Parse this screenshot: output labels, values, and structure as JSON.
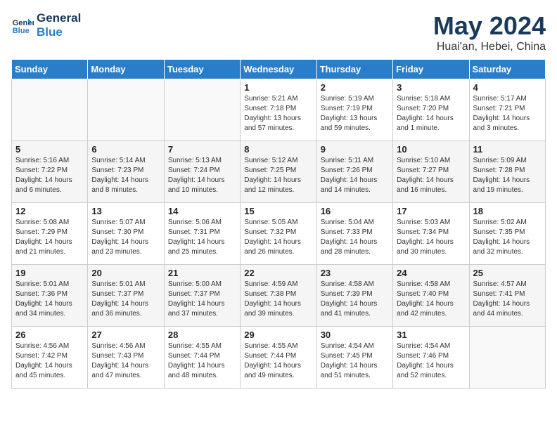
{
  "header": {
    "logo_line1": "General",
    "logo_line2": "Blue",
    "month": "May 2024",
    "location": "Huai'an, Hebei, China"
  },
  "days_of_week": [
    "Sunday",
    "Monday",
    "Tuesday",
    "Wednesday",
    "Thursday",
    "Friday",
    "Saturday"
  ],
  "weeks": [
    [
      {
        "day": "",
        "info": ""
      },
      {
        "day": "",
        "info": ""
      },
      {
        "day": "",
        "info": ""
      },
      {
        "day": "1",
        "info": "Sunrise: 5:21 AM\nSunset: 7:18 PM\nDaylight: 13 hours\nand 57 minutes."
      },
      {
        "day": "2",
        "info": "Sunrise: 5:19 AM\nSunset: 7:19 PM\nDaylight: 13 hours\nand 59 minutes."
      },
      {
        "day": "3",
        "info": "Sunrise: 5:18 AM\nSunset: 7:20 PM\nDaylight: 14 hours\nand 1 minute."
      },
      {
        "day": "4",
        "info": "Sunrise: 5:17 AM\nSunset: 7:21 PM\nDaylight: 14 hours\nand 3 minutes."
      }
    ],
    [
      {
        "day": "5",
        "info": "Sunrise: 5:16 AM\nSunset: 7:22 PM\nDaylight: 14 hours\nand 6 minutes."
      },
      {
        "day": "6",
        "info": "Sunrise: 5:14 AM\nSunset: 7:23 PM\nDaylight: 14 hours\nand 8 minutes."
      },
      {
        "day": "7",
        "info": "Sunrise: 5:13 AM\nSunset: 7:24 PM\nDaylight: 14 hours\nand 10 minutes."
      },
      {
        "day": "8",
        "info": "Sunrise: 5:12 AM\nSunset: 7:25 PM\nDaylight: 14 hours\nand 12 minutes."
      },
      {
        "day": "9",
        "info": "Sunrise: 5:11 AM\nSunset: 7:26 PM\nDaylight: 14 hours\nand 14 minutes."
      },
      {
        "day": "10",
        "info": "Sunrise: 5:10 AM\nSunset: 7:27 PM\nDaylight: 14 hours\nand 16 minutes."
      },
      {
        "day": "11",
        "info": "Sunrise: 5:09 AM\nSunset: 7:28 PM\nDaylight: 14 hours\nand 19 minutes."
      }
    ],
    [
      {
        "day": "12",
        "info": "Sunrise: 5:08 AM\nSunset: 7:29 PM\nDaylight: 14 hours\nand 21 minutes."
      },
      {
        "day": "13",
        "info": "Sunrise: 5:07 AM\nSunset: 7:30 PM\nDaylight: 14 hours\nand 23 minutes."
      },
      {
        "day": "14",
        "info": "Sunrise: 5:06 AM\nSunset: 7:31 PM\nDaylight: 14 hours\nand 25 minutes."
      },
      {
        "day": "15",
        "info": "Sunrise: 5:05 AM\nSunset: 7:32 PM\nDaylight: 14 hours\nand 26 minutes."
      },
      {
        "day": "16",
        "info": "Sunrise: 5:04 AM\nSunset: 7:33 PM\nDaylight: 14 hours\nand 28 minutes."
      },
      {
        "day": "17",
        "info": "Sunrise: 5:03 AM\nSunset: 7:34 PM\nDaylight: 14 hours\nand 30 minutes."
      },
      {
        "day": "18",
        "info": "Sunrise: 5:02 AM\nSunset: 7:35 PM\nDaylight: 14 hours\nand 32 minutes."
      }
    ],
    [
      {
        "day": "19",
        "info": "Sunrise: 5:01 AM\nSunset: 7:36 PM\nDaylight: 14 hours\nand 34 minutes."
      },
      {
        "day": "20",
        "info": "Sunrise: 5:01 AM\nSunset: 7:37 PM\nDaylight: 14 hours\nand 36 minutes."
      },
      {
        "day": "21",
        "info": "Sunrise: 5:00 AM\nSunset: 7:37 PM\nDaylight: 14 hours\nand 37 minutes."
      },
      {
        "day": "22",
        "info": "Sunrise: 4:59 AM\nSunset: 7:38 PM\nDaylight: 14 hours\nand 39 minutes."
      },
      {
        "day": "23",
        "info": "Sunrise: 4:58 AM\nSunset: 7:39 PM\nDaylight: 14 hours\nand 41 minutes."
      },
      {
        "day": "24",
        "info": "Sunrise: 4:58 AM\nSunset: 7:40 PM\nDaylight: 14 hours\nand 42 minutes."
      },
      {
        "day": "25",
        "info": "Sunrise: 4:57 AM\nSunset: 7:41 PM\nDaylight: 14 hours\nand 44 minutes."
      }
    ],
    [
      {
        "day": "26",
        "info": "Sunrise: 4:56 AM\nSunset: 7:42 PM\nDaylight: 14 hours\nand 45 minutes."
      },
      {
        "day": "27",
        "info": "Sunrise: 4:56 AM\nSunset: 7:43 PM\nDaylight: 14 hours\nand 47 minutes."
      },
      {
        "day": "28",
        "info": "Sunrise: 4:55 AM\nSunset: 7:44 PM\nDaylight: 14 hours\nand 48 minutes."
      },
      {
        "day": "29",
        "info": "Sunrise: 4:55 AM\nSunset: 7:44 PM\nDaylight: 14 hours\nand 49 minutes."
      },
      {
        "day": "30",
        "info": "Sunrise: 4:54 AM\nSunset: 7:45 PM\nDaylight: 14 hours\nand 51 minutes."
      },
      {
        "day": "31",
        "info": "Sunrise: 4:54 AM\nSunset: 7:46 PM\nDaylight: 14 hours\nand 52 minutes."
      },
      {
        "day": "",
        "info": ""
      }
    ]
  ]
}
